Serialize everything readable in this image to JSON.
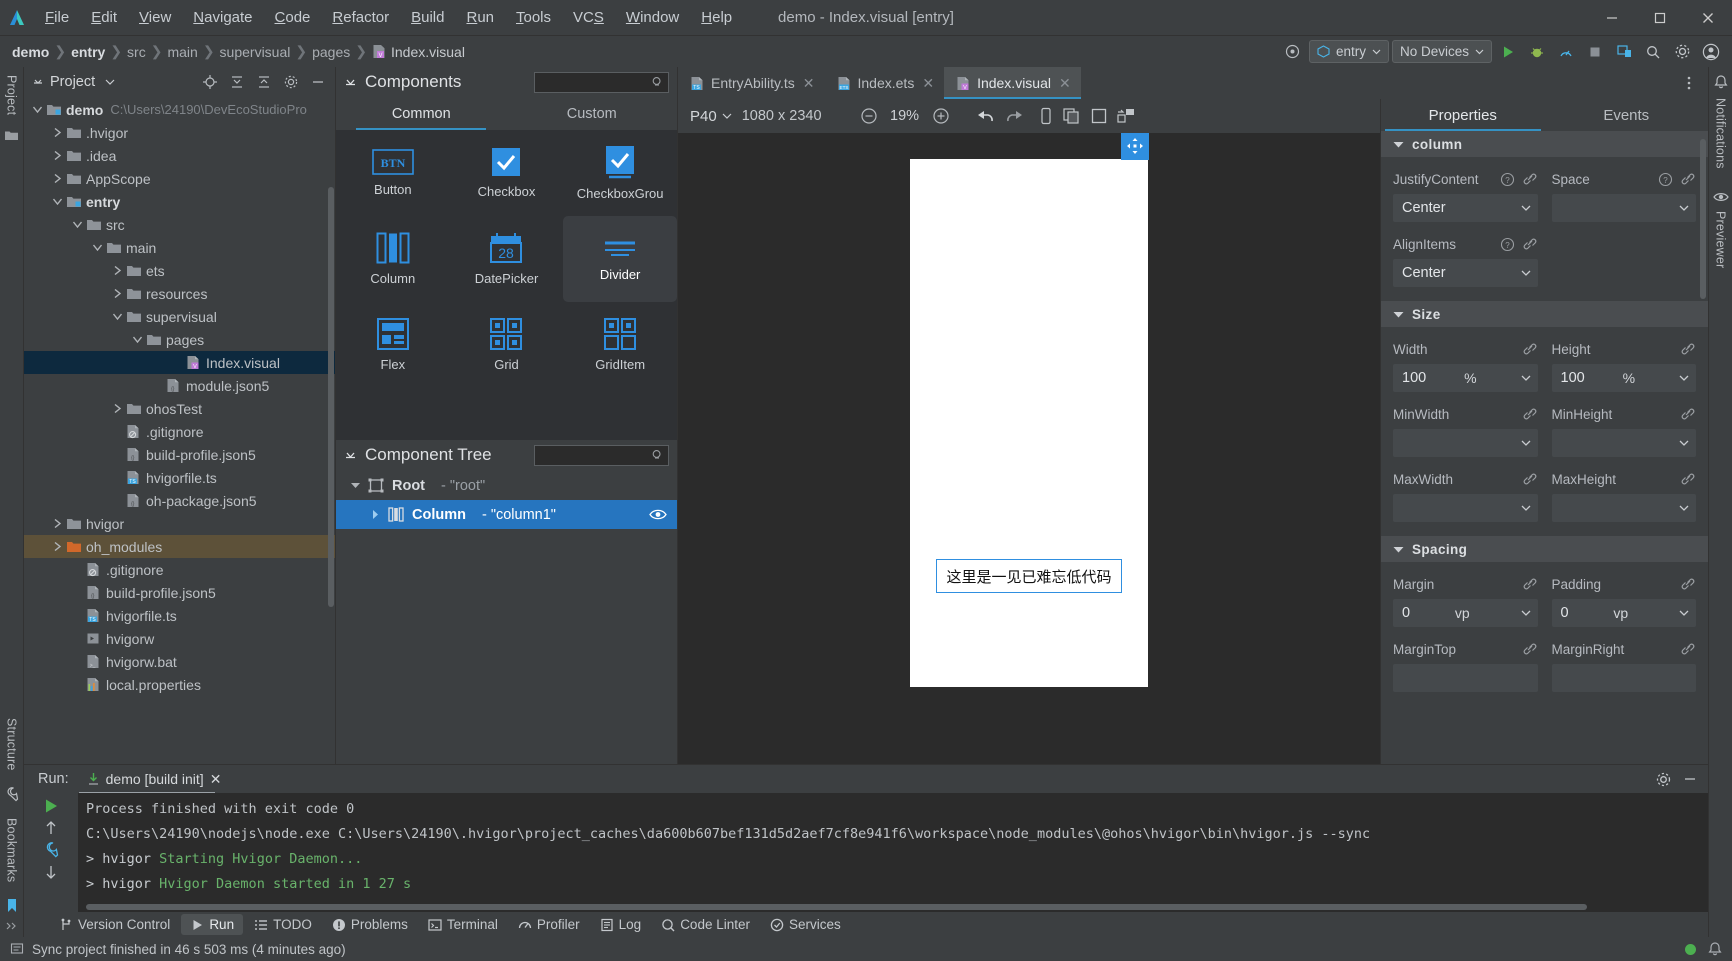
{
  "window": {
    "title": "demo - Index.visual [entry]",
    "logo_icon": "deveco-logo-icon",
    "minimize_label": "—",
    "maximize_label": "☐",
    "close_label": "✕"
  },
  "menubar": {
    "items": [
      {
        "label": "File",
        "mnemonic": "F"
      },
      {
        "label": "Edit",
        "mnemonic": "E"
      },
      {
        "label": "View",
        "mnemonic": "V"
      },
      {
        "label": "Navigate",
        "mnemonic": "N"
      },
      {
        "label": "Code",
        "mnemonic": "C"
      },
      {
        "label": "Refactor",
        "mnemonic": "R"
      },
      {
        "label": "Build",
        "mnemonic": "B"
      },
      {
        "label": "Run",
        "mnemonic": "R"
      },
      {
        "label": "Tools",
        "mnemonic": "T"
      },
      {
        "label": "VCS",
        "mnemonic": "S"
      },
      {
        "label": "Window",
        "mnemonic": "W"
      },
      {
        "label": "Help",
        "mnemonic": "H"
      }
    ]
  },
  "breadcrumb": {
    "items": [
      "demo",
      "entry",
      "src",
      "main",
      "supervisual",
      "pages"
    ],
    "file": "Index.visual",
    "separator": "❯"
  },
  "navbar_right": {
    "target_icon": "target-device-icon",
    "run_config": "entry",
    "device_select": "No Devices",
    "buttons": [
      {
        "name": "run-button",
        "icon": "play-icon"
      },
      {
        "name": "debug-button",
        "icon": "bug-icon"
      },
      {
        "name": "profile-button",
        "icon": "profiler-icon"
      },
      {
        "name": "stop-button",
        "icon": "stop-icon"
      },
      {
        "name": "device-manager-button",
        "icon": "device-manager-icon"
      },
      {
        "name": "search-everywhere-button",
        "icon": "search-icon"
      },
      {
        "name": "settings-button",
        "icon": "gear-icon"
      },
      {
        "name": "account-button",
        "icon": "account-icon"
      }
    ]
  },
  "left_rail": {
    "tool_tab": "Project",
    "structure_tab": "Structure",
    "bookmarks_tab": "Bookmarks",
    "folder_icon": "folder-icon",
    "expand_icons": [
      "chevrons-right-icon",
      "chevrons-right-icon"
    ],
    "pin_icon": "bookmark-icon",
    "wrench_icon": "wrench-icon"
  },
  "right_rail": {
    "notifications_tab": "Notifications",
    "previewer_tab": "Previewer",
    "bell_icon": "bell-icon",
    "eye_icon": "eye-icon"
  },
  "project_panel": {
    "title": "Project",
    "chevron_icon": "chevron-down-icon",
    "head_buttons": [
      {
        "name": "locate-button",
        "icon": "crosshair-icon"
      },
      {
        "name": "expand-all-button",
        "icon": "expand-all-icon"
      },
      {
        "name": "collapse-all-button",
        "icon": "collapse-all-icon"
      },
      {
        "name": "settings-button",
        "icon": "gear-icon"
      },
      {
        "name": "hide-button",
        "icon": "minus-icon"
      }
    ],
    "tree": [
      {
        "label": "demo",
        "path": "C:\\Users\\24190\\DevEcoStudioPro",
        "indent": 0,
        "twisty": "open",
        "icon": "module-folder-icon",
        "bold": true,
        "state": "none"
      },
      {
        "label": ".hvigor",
        "indent": 1,
        "twisty": "closed",
        "icon": "folder-icon",
        "state": "none"
      },
      {
        "label": ".idea",
        "indent": 1,
        "twisty": "closed",
        "icon": "folder-icon",
        "state": "none"
      },
      {
        "label": "AppScope",
        "indent": 1,
        "twisty": "closed",
        "icon": "folder-icon",
        "state": "none"
      },
      {
        "label": "entry",
        "indent": 1,
        "twisty": "open",
        "icon": "module-folder-icon",
        "bold": true,
        "state": "none"
      },
      {
        "label": "src",
        "indent": 2,
        "twisty": "open",
        "icon": "folder-icon",
        "state": "none"
      },
      {
        "label": "main",
        "indent": 3,
        "twisty": "open",
        "icon": "folder-icon",
        "state": "none"
      },
      {
        "label": "ets",
        "indent": 4,
        "twisty": "closed",
        "icon": "folder-icon",
        "state": "none"
      },
      {
        "label": "resources",
        "indent": 4,
        "twisty": "closed",
        "icon": "folder-icon",
        "state": "none"
      },
      {
        "label": "supervisual",
        "indent": 4,
        "twisty": "open",
        "icon": "folder-icon",
        "state": "none"
      },
      {
        "label": "pages",
        "indent": 5,
        "twisty": "open",
        "icon": "folder-icon",
        "state": "none"
      },
      {
        "label": "Index.visual",
        "indent": 7,
        "twisty": "none",
        "icon": "visual-file-icon",
        "state": "selected"
      },
      {
        "label": "module.json5",
        "indent": 6,
        "twisty": "none",
        "icon": "json5-file-icon",
        "state": "none"
      },
      {
        "label": "ohosTest",
        "indent": 4,
        "twisty": "closed",
        "icon": "folder-icon",
        "state": "none"
      },
      {
        "label": ".gitignore",
        "indent": 4,
        "twisty": "none",
        "icon": "gitignore-file-icon",
        "state": "none"
      },
      {
        "label": "build-profile.json5",
        "indent": 4,
        "twisty": "none",
        "icon": "json5-file-icon",
        "state": "none"
      },
      {
        "label": "hvigorfile.ts",
        "indent": 4,
        "twisty": "none",
        "icon": "ts-file-icon",
        "state": "none"
      },
      {
        "label": "oh-package.json5",
        "indent": 4,
        "twisty": "none",
        "icon": "json5-file-icon",
        "state": "none"
      },
      {
        "label": "hvigor",
        "indent": 1,
        "twisty": "closed",
        "icon": "folder-icon",
        "state": "none"
      },
      {
        "label": "oh_modules",
        "indent": 1,
        "twisty": "closed",
        "icon": "orange-folder-icon",
        "state": "highlighted"
      },
      {
        "label": ".gitignore",
        "indent": 2,
        "twisty": "none",
        "icon": "gitignore-file-icon",
        "state": "none"
      },
      {
        "label": "build-profile.json5",
        "indent": 2,
        "twisty": "none",
        "icon": "json5-file-icon",
        "state": "none"
      },
      {
        "label": "hvigorfile.ts",
        "indent": 2,
        "twisty": "none",
        "icon": "ts-file-icon",
        "state": "none"
      },
      {
        "label": "hvigorw",
        "indent": 2,
        "twisty": "none",
        "icon": "script-file-icon",
        "state": "none"
      },
      {
        "label": "hvigorw.bat",
        "indent": 2,
        "twisty": "none",
        "icon": "bat-file-icon",
        "state": "none"
      },
      {
        "label": "local.properties",
        "indent": 2,
        "twisty": "none",
        "icon": "properties-file-icon",
        "state": "none"
      }
    ]
  },
  "components_panel": {
    "title": "Components",
    "chevron_icon": "chevron-down-icon",
    "search_placeholder": "",
    "search_value": "",
    "search_icon": "search-icon",
    "tabs": [
      {
        "label": "Common",
        "active": true
      },
      {
        "label": "Custom",
        "active": false
      }
    ],
    "items": [
      {
        "label": "Button",
        "icon": "button-icon",
        "hover": false
      },
      {
        "label": "Checkbox",
        "icon": "checkbox-icon",
        "hover": false
      },
      {
        "label": "CheckboxGrou",
        "icon": "checkbox-group-icon",
        "hover": false
      },
      {
        "label": "Column",
        "icon": "column-icon",
        "hover": false
      },
      {
        "label": "DatePicker",
        "icon": "datepicker-icon",
        "icon_text": "28",
        "hover": false
      },
      {
        "label": "Divider",
        "icon": "divider-icon",
        "hover": true
      },
      {
        "label": "Flex",
        "icon": "flex-icon",
        "hover": false
      },
      {
        "label": "Grid",
        "icon": "grid-icon",
        "hover": false
      },
      {
        "label": "GridItem",
        "icon": "griditem-icon",
        "hover": false
      }
    ]
  },
  "component_tree": {
    "title": "Component Tree",
    "chevron_icon": "chevron-down-icon",
    "search_value": "",
    "search_icon": "search-icon",
    "rows": [
      {
        "name": "Root",
        "value": "- \"root\"",
        "indent": 0,
        "twisty": "open",
        "icon": "root-node-icon",
        "selected": false,
        "eye": false
      },
      {
        "name": "Column",
        "value": "- \"column1\"",
        "indent": 1,
        "twisty": "closed",
        "icon": "column-node-icon",
        "selected": true,
        "eye": true
      }
    ]
  },
  "editor_tabs": {
    "tabs": [
      {
        "label": "EntryAbility.ts",
        "icon": "ts-file-icon",
        "active": false,
        "closable": true
      },
      {
        "label": "Index.ets",
        "icon": "ets-file-icon",
        "active": false,
        "closable": true
      },
      {
        "label": "Index.visual",
        "icon": "visual-file-icon",
        "active": true,
        "closable": true
      }
    ],
    "more_icon": "more-vertical-icon",
    "close_label": "✕"
  },
  "canvas_toolbar": {
    "device": "P40",
    "device_chevron": "chevron-down-icon",
    "resolution": "1080 x 2340",
    "zoom_out_icon": "minus-circle-icon",
    "zoom_value": "19%",
    "zoom_in_icon": "plus-circle-icon",
    "buttons": [
      {
        "name": "undo-button",
        "icon": "undo-arrow-icon"
      },
      {
        "name": "redo-button",
        "icon": "redo-arrow-icon"
      },
      {
        "name": "device-orientation-button",
        "icon": "phone-icon"
      },
      {
        "name": "copy-link-button",
        "icon": "copy-layers-icon"
      },
      {
        "name": "frame-button",
        "icon": "square-icon"
      },
      {
        "name": "refresh-layout-button",
        "icon": "refresh-layout-icon"
      }
    ]
  },
  "canvas": {
    "drag_handle_icon": "move-handle-icon",
    "text_widget": "这里是一见已难忘低代码"
  },
  "properties_panel": {
    "tabs": [
      {
        "label": "Properties",
        "active": true
      },
      {
        "label": "Events",
        "active": false
      }
    ],
    "groups": [
      {
        "name": "column",
        "chevron_icon": "chevron-down-icon",
        "rows": [
          {
            "left": {
              "label": "JustifyContent",
              "value": "Center",
              "unit": "",
              "help": true,
              "link": true,
              "dropdown": true
            },
            "right": {
              "label": "Space",
              "value": "",
              "unit": "",
              "help": true,
              "link": true,
              "dropdown": true
            }
          },
          {
            "left": {
              "label": "AlignItems",
              "value": "Center",
              "unit": "",
              "help": true,
              "link": true,
              "dropdown": true
            },
            "right": {
              "label": "",
              "value": "",
              "unit": "",
              "help": false,
              "link": false,
              "dropdown": false
            }
          }
        ]
      },
      {
        "name": "Size",
        "chevron_icon": "chevron-down-icon",
        "rows": [
          {
            "left": {
              "label": "Width",
              "value": "100",
              "unit": "%",
              "help": false,
              "link": true,
              "dropdown": true
            },
            "right": {
              "label": "Height",
              "value": "100",
              "unit": "%",
              "help": false,
              "link": true,
              "dropdown": true
            }
          },
          {
            "left": {
              "label": "MinWidth",
              "value": "",
              "unit": "",
              "help": false,
              "link": true,
              "dropdown": true
            },
            "right": {
              "label": "MinHeight",
              "value": "",
              "unit": "",
              "help": false,
              "link": true,
              "dropdown": true
            }
          },
          {
            "left": {
              "label": "MaxWidth",
              "value": "",
              "unit": "",
              "help": false,
              "link": true,
              "dropdown": true
            },
            "right": {
              "label": "MaxHeight",
              "value": "",
              "unit": "",
              "help": false,
              "link": true,
              "dropdown": true
            }
          }
        ]
      },
      {
        "name": "Spacing",
        "chevron_icon": "chevron-down-icon",
        "rows": [
          {
            "left": {
              "label": "Margin",
              "value": "0",
              "unit": "vp",
              "help": false,
              "link": true,
              "dropdown": true
            },
            "right": {
              "label": "Padding",
              "value": "0",
              "unit": "vp",
              "help": false,
              "link": true,
              "dropdown": true
            }
          },
          {
            "left": {
              "label": "MarginTop",
              "value": "",
              "unit": "",
              "help": false,
              "link": true,
              "dropdown": false
            },
            "right": {
              "label": "MarginRight",
              "value": "",
              "unit": "",
              "help": false,
              "link": true,
              "dropdown": false
            }
          }
        ]
      }
    ]
  },
  "run_panel": {
    "label": "Run:",
    "tab": "demo [build init]",
    "tab_icon": "download-arrow-icon",
    "tab_close": "✕",
    "settings_icon": "gear-icon",
    "hide_icon": "minus-icon",
    "gutter_buttons": [
      {
        "name": "rerun-button",
        "icon": "play-green-icon"
      },
      {
        "name": "scroll-up-button",
        "icon": "arrow-up-icon"
      },
      {
        "name": "soft-wrap-button",
        "icon": "wrench-icon"
      },
      {
        "name": "scroll-down-button",
        "icon": "arrow-down-icon"
      }
    ],
    "console_lines": [
      {
        "text": "Process finished with exit code 0",
        "color": "normal"
      },
      {
        "text": "C:\\Users\\24190\\nodejs\\node.exe C:\\Users\\24190\\.hvigor\\project_caches\\da600b607bef131d5d2aef7cf8e941f6\\workspace\\node_modules\\@ohos\\hvigor\\bin\\hvigor.js --sync",
        "color": "normal"
      },
      {
        "prefix": "> hvigor ",
        "text": "Starting Hvigor Daemon...",
        "color": "green"
      },
      {
        "prefix": "> hvigor ",
        "text": "Hvigor Daemon started in 1 27 s",
        "color": "green"
      }
    ]
  },
  "bottom_toolbar": {
    "items": [
      {
        "label": "Version Control",
        "icon": "branch-icon",
        "active": false
      },
      {
        "label": "Run",
        "icon": "play-icon",
        "active": true
      },
      {
        "label": "TODO",
        "icon": "list-icon",
        "active": false
      },
      {
        "label": "Problems",
        "icon": "warning-icon",
        "active": false
      },
      {
        "label": "Terminal",
        "icon": "terminal-icon",
        "active": false
      },
      {
        "label": "Profiler",
        "icon": "gauge-icon",
        "active": false
      },
      {
        "label": "Log",
        "icon": "log-icon",
        "active": false
      },
      {
        "label": "Code Linter",
        "icon": "linter-icon",
        "active": false
      },
      {
        "label": "Services",
        "icon": "services-icon",
        "active": false
      }
    ]
  },
  "status_bar": {
    "icon": "event-log-icon",
    "message": "Sync project finished in 46 s 503 ms (4 minutes ago)",
    "indicator_color": "#4caf50",
    "right_icon": "bell-icon"
  }
}
